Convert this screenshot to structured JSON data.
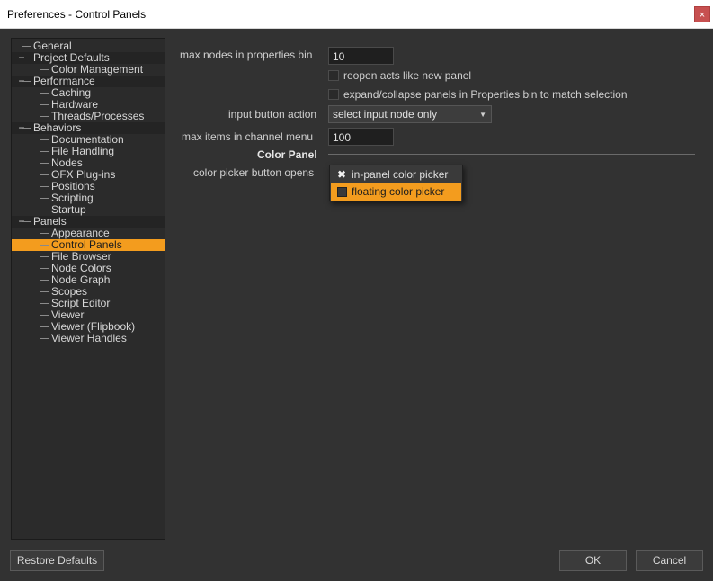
{
  "window": {
    "title": "Preferences - Control Panels",
    "close_glyph": "×"
  },
  "tree": {
    "items": [
      {
        "label": "General",
        "level": 0
      },
      {
        "label": "Project Defaults",
        "level": 0,
        "expander": "−"
      },
      {
        "label": "Color Management",
        "level": 1
      },
      {
        "label": "Performance",
        "level": 0,
        "expander": "−"
      },
      {
        "label": "Caching",
        "level": 1
      },
      {
        "label": "Hardware",
        "level": 1
      },
      {
        "label": "Threads/Processes",
        "level": 1
      },
      {
        "label": "Behaviors",
        "level": 0,
        "expander": "−"
      },
      {
        "label": "Documentation",
        "level": 1
      },
      {
        "label": "File Handling",
        "level": 1
      },
      {
        "label": "Nodes",
        "level": 1
      },
      {
        "label": "OFX Plug-ins",
        "level": 1
      },
      {
        "label": "Positions",
        "level": 1
      },
      {
        "label": "Scripting",
        "level": 1
      },
      {
        "label": "Startup",
        "level": 1
      },
      {
        "label": "Panels",
        "level": 0,
        "expander": "−"
      },
      {
        "label": "Appearance",
        "level": 1
      },
      {
        "label": "Control Panels",
        "level": 1,
        "selected": true
      },
      {
        "label": "File Browser",
        "level": 1
      },
      {
        "label": "Node Colors",
        "level": 1
      },
      {
        "label": "Node Graph",
        "level": 1
      },
      {
        "label": "Scopes",
        "level": 1
      },
      {
        "label": "Script Editor",
        "level": 1
      },
      {
        "label": "Viewer",
        "level": 1
      },
      {
        "label": "Viewer (Flipbook)",
        "level": 1
      },
      {
        "label": "Viewer Handles",
        "level": 1
      }
    ]
  },
  "form": {
    "max_nodes_label": "max nodes in properties bin",
    "max_nodes_value": "10",
    "reopen_label": "reopen acts like new panel",
    "reopen_checked": false,
    "expand_label": "expand/collapse panels in Properties bin to match selection",
    "expand_checked": false,
    "input_button_label": "input button action",
    "input_button_value": "select input node only",
    "max_items_label": "max items in channel menu",
    "max_items_value": "100",
    "color_panel_title": "Color Panel",
    "color_picker_label": "color picker button opens",
    "color_picker_options": [
      {
        "label": "in-panel color picker",
        "checked": true,
        "mark": "✖"
      },
      {
        "label": "floating color picker",
        "highlighted": true
      }
    ]
  },
  "buttons": {
    "restore": "Restore Defaults",
    "ok": "OK",
    "cancel": "Cancel"
  },
  "colors": {
    "accent": "#f39c1e",
    "background": "#323232"
  }
}
